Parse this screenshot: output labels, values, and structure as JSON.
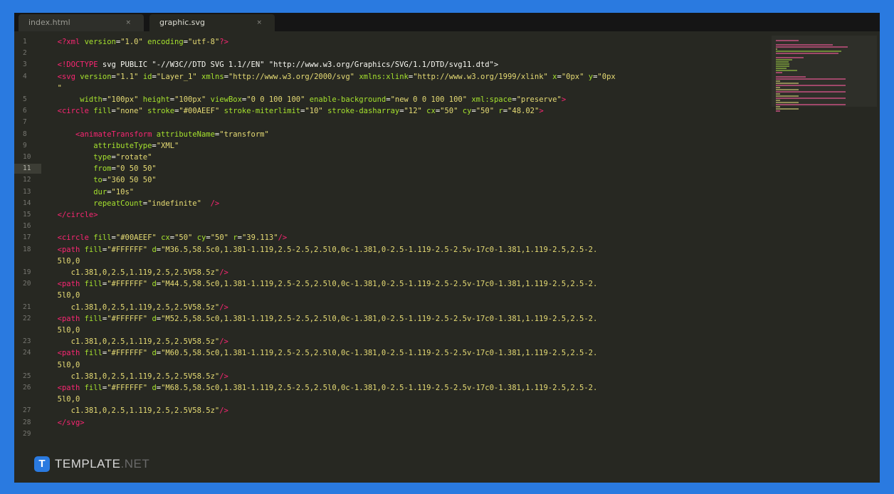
{
  "tabs": [
    {
      "label": "index.html",
      "close": "×",
      "active": false
    },
    {
      "label": "graphic.svg",
      "close": "×",
      "active": true
    }
  ],
  "editor": {
    "highlighted_line": "11",
    "lines": [
      {
        "n": "1",
        "parts": [
          [
            "tx",
            "  "
          ],
          [
            "tg",
            "<?xml "
          ],
          [
            "at",
            "version"
          ],
          [
            "tx",
            "="
          ],
          [
            "st",
            "\"1.0\""
          ],
          [
            "tx",
            " "
          ],
          [
            "at",
            "encoding"
          ],
          [
            "tx",
            "="
          ],
          [
            "st",
            "\"utf-8\""
          ],
          [
            "tg",
            "?>"
          ]
        ]
      },
      {
        "n": "2",
        "parts": []
      },
      {
        "n": "3",
        "parts": [
          [
            "tx",
            "  "
          ],
          [
            "tg",
            "<!DOCTYPE"
          ],
          [
            "tx",
            " svg PUBLIC \"-//W3C//DTD SVG 1.1//EN\" \"http://www.w3.org/Graphics/SVG/1.1/DTD/svg11.dtd\">"
          ]
        ]
      },
      {
        "n": "4",
        "parts": [
          [
            "tx",
            "  "
          ],
          [
            "tg",
            "<svg"
          ],
          [
            "tx",
            " "
          ],
          [
            "at",
            "version"
          ],
          [
            "tx",
            "="
          ],
          [
            "st",
            "\"1.1\""
          ],
          [
            "tx",
            " "
          ],
          [
            "at",
            "id"
          ],
          [
            "tx",
            "="
          ],
          [
            "st",
            "\"Layer_1\""
          ],
          [
            "tx",
            " "
          ],
          [
            "at",
            "xmlns"
          ],
          [
            "tx",
            "="
          ],
          [
            "st",
            "\"http://www.w3.org/2000/svg\""
          ],
          [
            "tx",
            " "
          ],
          [
            "at",
            "xmlns:xlink"
          ],
          [
            "tx",
            "="
          ],
          [
            "st",
            "\"http://www.w3.org/1999/xlink\""
          ],
          [
            "tx",
            " "
          ],
          [
            "at",
            "x"
          ],
          [
            "tx",
            "="
          ],
          [
            "st",
            "\"0px\""
          ],
          [
            "tx",
            " "
          ],
          [
            "at",
            "y"
          ],
          [
            "tx",
            "="
          ],
          [
            "st",
            "\"0px"
          ]
        ]
      },
      {
        "n": "",
        "parts": [
          [
            "tx",
            "  "
          ],
          [
            "st",
            "\""
          ]
        ]
      },
      {
        "n": "5",
        "parts": [
          [
            "tx",
            "       "
          ],
          [
            "at",
            "width"
          ],
          [
            "tx",
            "="
          ],
          [
            "st",
            "\"100px\""
          ],
          [
            "tx",
            " "
          ],
          [
            "at",
            "height"
          ],
          [
            "tx",
            "="
          ],
          [
            "st",
            "\"100px\""
          ],
          [
            "tx",
            " "
          ],
          [
            "at",
            "viewBox"
          ],
          [
            "tx",
            "="
          ],
          [
            "st",
            "\"0 0 100 100\""
          ],
          [
            "tx",
            " "
          ],
          [
            "at",
            "enable-background"
          ],
          [
            "tx",
            "="
          ],
          [
            "st",
            "\"new 0 0 100 100\""
          ],
          [
            "tx",
            " "
          ],
          [
            "at",
            "xml:space"
          ],
          [
            "tx",
            "="
          ],
          [
            "st",
            "\"preserve\""
          ],
          [
            "tg",
            ">"
          ]
        ]
      },
      {
        "n": "6",
        "parts": [
          [
            "tx",
            "  "
          ],
          [
            "tg",
            "<circle"
          ],
          [
            "tx",
            " "
          ],
          [
            "at",
            "fill"
          ],
          [
            "tx",
            "="
          ],
          [
            "st",
            "\"none\""
          ],
          [
            "tx",
            " "
          ],
          [
            "at",
            "stroke"
          ],
          [
            "tx",
            "="
          ],
          [
            "st",
            "\"#00AEEF\""
          ],
          [
            "tx",
            " "
          ],
          [
            "at",
            "stroke-miterlimit"
          ],
          [
            "tx",
            "="
          ],
          [
            "st",
            "\"10\""
          ],
          [
            "tx",
            " "
          ],
          [
            "at",
            "stroke-dasharray"
          ],
          [
            "tx",
            "="
          ],
          [
            "st",
            "\"12\""
          ],
          [
            "tx",
            " "
          ],
          [
            "at",
            "cx"
          ],
          [
            "tx",
            "="
          ],
          [
            "st",
            "\"50\""
          ],
          [
            "tx",
            " "
          ],
          [
            "at",
            "cy"
          ],
          [
            "tx",
            "="
          ],
          [
            "st",
            "\"50\""
          ],
          [
            "tx",
            " "
          ],
          [
            "at",
            "r"
          ],
          [
            "tx",
            "="
          ],
          [
            "st",
            "\"48.02\""
          ],
          [
            "tg",
            ">"
          ]
        ]
      },
      {
        "n": "7",
        "parts": []
      },
      {
        "n": "8",
        "parts": [
          [
            "tx",
            "      "
          ],
          [
            "tg",
            "<animateTransform"
          ],
          [
            "tx",
            " "
          ],
          [
            "at",
            "attributeName"
          ],
          [
            "tx",
            "="
          ],
          [
            "st",
            "\"transform\""
          ]
        ]
      },
      {
        "n": "9",
        "parts": [
          [
            "tx",
            "          "
          ],
          [
            "at",
            "attributeType"
          ],
          [
            "tx",
            "="
          ],
          [
            "st",
            "\"XML\""
          ]
        ]
      },
      {
        "n": "10",
        "parts": [
          [
            "tx",
            "          "
          ],
          [
            "at",
            "type"
          ],
          [
            "tx",
            "="
          ],
          [
            "st",
            "\"rotate\""
          ]
        ]
      },
      {
        "n": "11",
        "parts": [
          [
            "tx",
            "          "
          ],
          [
            "at",
            "from"
          ],
          [
            "tx",
            "="
          ],
          [
            "st",
            "\"0 50 50\""
          ]
        ]
      },
      {
        "n": "12",
        "parts": [
          [
            "tx",
            "          "
          ],
          [
            "at",
            "to"
          ],
          [
            "tx",
            "="
          ],
          [
            "st",
            "\"360 50 50\""
          ]
        ]
      },
      {
        "n": "13",
        "parts": [
          [
            "tx",
            "          "
          ],
          [
            "at",
            "dur"
          ],
          [
            "tx",
            "="
          ],
          [
            "st",
            "\"10s\""
          ]
        ]
      },
      {
        "n": "14",
        "parts": [
          [
            "tx",
            "          "
          ],
          [
            "at",
            "repeatCount"
          ],
          [
            "tx",
            "="
          ],
          [
            "st",
            "\"indefinite\""
          ],
          [
            "tx",
            "  "
          ],
          [
            "tg",
            "/>"
          ]
        ]
      },
      {
        "n": "15",
        "parts": [
          [
            "tx",
            "  "
          ],
          [
            "tg",
            "</circle>"
          ]
        ]
      },
      {
        "n": "16",
        "parts": []
      },
      {
        "n": "17",
        "parts": [
          [
            "tx",
            "  "
          ],
          [
            "tg",
            "<circle"
          ],
          [
            "tx",
            " "
          ],
          [
            "at",
            "fill"
          ],
          [
            "tx",
            "="
          ],
          [
            "st",
            "\"#00AEEF\""
          ],
          [
            "tx",
            " "
          ],
          [
            "at",
            "cx"
          ],
          [
            "tx",
            "="
          ],
          [
            "st",
            "\"50\""
          ],
          [
            "tx",
            " "
          ],
          [
            "at",
            "cy"
          ],
          [
            "tx",
            "="
          ],
          [
            "st",
            "\"50\""
          ],
          [
            "tx",
            " "
          ],
          [
            "at",
            "r"
          ],
          [
            "tx",
            "="
          ],
          [
            "st",
            "\"39.113\""
          ],
          [
            "tg",
            "/>"
          ]
        ]
      },
      {
        "n": "18",
        "parts": [
          [
            "tx",
            "  "
          ],
          [
            "tg",
            "<path"
          ],
          [
            "tx",
            " "
          ],
          [
            "at",
            "fill"
          ],
          [
            "tx",
            "="
          ],
          [
            "st",
            "\"#FFFFFF\""
          ],
          [
            "tx",
            " "
          ],
          [
            "at",
            "d"
          ],
          [
            "tx",
            "="
          ],
          [
            "st",
            "\"M36.5,58.5c0,1.381-1.119,2.5-2.5,2.5l0,0c-1.381,0-2.5-1.119-2.5-2.5v-17c0-1.381,1.119-2.5,2.5-2."
          ]
        ]
      },
      {
        "n": "",
        "parts": [
          [
            "tx",
            "  "
          ],
          [
            "st",
            "5l0,0"
          ]
        ]
      },
      {
        "n": "19",
        "parts": [
          [
            "tx",
            "     "
          ],
          [
            "st",
            "c1.381,0,2.5,1.119,2.5,2.5V58.5z\""
          ],
          [
            "tg",
            "/>"
          ]
        ]
      },
      {
        "n": "20",
        "parts": [
          [
            "tx",
            "  "
          ],
          [
            "tg",
            "<path"
          ],
          [
            "tx",
            " "
          ],
          [
            "at",
            "fill"
          ],
          [
            "tx",
            "="
          ],
          [
            "st",
            "\"#FFFFFF\""
          ],
          [
            "tx",
            " "
          ],
          [
            "at",
            "d"
          ],
          [
            "tx",
            "="
          ],
          [
            "st",
            "\"M44.5,58.5c0,1.381-1.119,2.5-2.5,2.5l0,0c-1.381,0-2.5-1.119-2.5-2.5v-17c0-1.381,1.119-2.5,2.5-2."
          ]
        ]
      },
      {
        "n": "",
        "parts": [
          [
            "tx",
            "  "
          ],
          [
            "st",
            "5l0,0"
          ]
        ]
      },
      {
        "n": "21",
        "parts": [
          [
            "tx",
            "     "
          ],
          [
            "st",
            "c1.381,0,2.5,1.119,2.5,2.5V58.5z\""
          ],
          [
            "tg",
            "/>"
          ]
        ]
      },
      {
        "n": "22",
        "parts": [
          [
            "tx",
            "  "
          ],
          [
            "tg",
            "<path"
          ],
          [
            "tx",
            " "
          ],
          [
            "at",
            "fill"
          ],
          [
            "tx",
            "="
          ],
          [
            "st",
            "\"#FFFFFF\""
          ],
          [
            "tx",
            " "
          ],
          [
            "at",
            "d"
          ],
          [
            "tx",
            "="
          ],
          [
            "st",
            "\"M52.5,58.5c0,1.381-1.119,2.5-2.5,2.5l0,0c-1.381,0-2.5-1.119-2.5-2.5v-17c0-1.381,1.119-2.5,2.5-2."
          ]
        ]
      },
      {
        "n": "",
        "parts": [
          [
            "tx",
            "  "
          ],
          [
            "st",
            "5l0,0"
          ]
        ]
      },
      {
        "n": "23",
        "parts": [
          [
            "tx",
            "     "
          ],
          [
            "st",
            "c1.381,0,2.5,1.119,2.5,2.5V58.5z\""
          ],
          [
            "tg",
            "/>"
          ]
        ]
      },
      {
        "n": "24",
        "parts": [
          [
            "tx",
            "  "
          ],
          [
            "tg",
            "<path"
          ],
          [
            "tx",
            " "
          ],
          [
            "at",
            "fill"
          ],
          [
            "tx",
            "="
          ],
          [
            "st",
            "\"#FFFFFF\""
          ],
          [
            "tx",
            " "
          ],
          [
            "at",
            "d"
          ],
          [
            "tx",
            "="
          ],
          [
            "st",
            "\"M60.5,58.5c0,1.381-1.119,2.5-2.5,2.5l0,0c-1.381,0-2.5-1.119-2.5-2.5v-17c0-1.381,1.119-2.5,2.5-2."
          ]
        ]
      },
      {
        "n": "",
        "parts": [
          [
            "tx",
            "  "
          ],
          [
            "st",
            "5l0,0"
          ]
        ]
      },
      {
        "n": "25",
        "parts": [
          [
            "tx",
            "     "
          ],
          [
            "st",
            "c1.381,0,2.5,1.119,2.5,2.5V58.5z\""
          ],
          [
            "tg",
            "/>"
          ]
        ]
      },
      {
        "n": "26",
        "parts": [
          [
            "tx",
            "  "
          ],
          [
            "tg",
            "<path"
          ],
          [
            "tx",
            " "
          ],
          [
            "at",
            "fill"
          ],
          [
            "tx",
            "="
          ],
          [
            "st",
            "\"#FFFFFF\""
          ],
          [
            "tx",
            " "
          ],
          [
            "at",
            "d"
          ],
          [
            "tx",
            "="
          ],
          [
            "st",
            "\"M68.5,58.5c0,1.381-1.119,2.5-2.5,2.5l0,0c-1.381,0-2.5-1.119-2.5-2.5v-17c0-1.381,1.119-2.5,2.5-2."
          ]
        ]
      },
      {
        "n": "",
        "parts": [
          [
            "tx",
            "  "
          ],
          [
            "st",
            "5l0,0"
          ]
        ]
      },
      {
        "n": "27",
        "parts": [
          [
            "tx",
            "     "
          ],
          [
            "st",
            "c1.381,0,2.5,1.119,2.5,2.5V58.5z\""
          ],
          [
            "tg",
            "/>"
          ]
        ]
      },
      {
        "n": "28",
        "parts": [
          [
            "tx",
            "  "
          ],
          [
            "tg",
            "</svg>"
          ]
        ]
      },
      {
        "n": "29",
        "parts": []
      }
    ]
  },
  "watermark": {
    "logo_letter": "T",
    "brand": "TEMPLATE",
    "suffix": ".NET"
  },
  "colors": {
    "background": "#2a7ae0",
    "editor_bg": "#272822",
    "tag": "#f92672",
    "attribute": "#a6e22e",
    "string": "#e6db74",
    "text": "#f8f8f2"
  }
}
